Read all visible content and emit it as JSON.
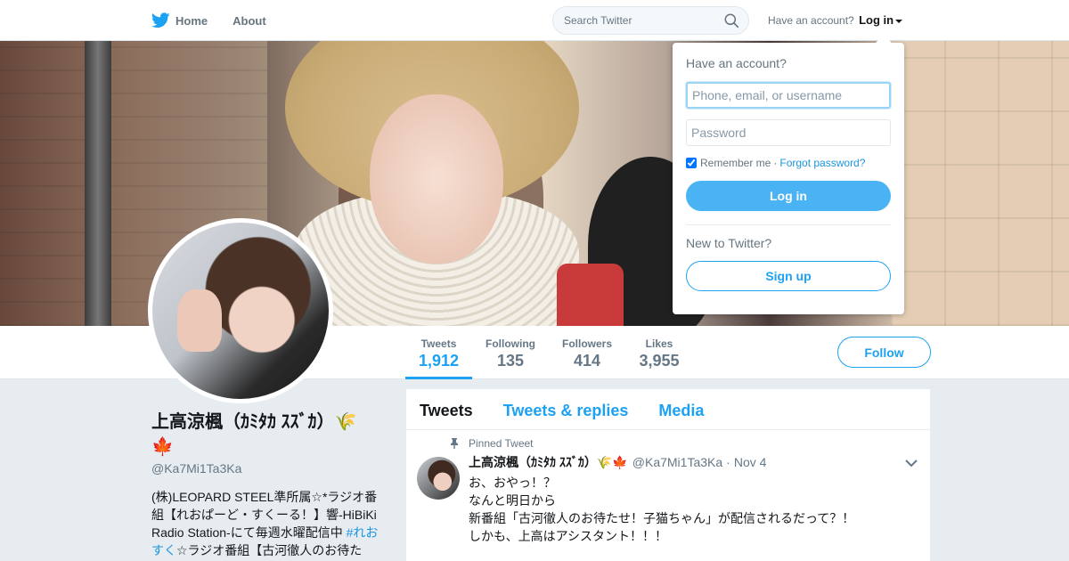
{
  "nav": {
    "home_label": "Home",
    "about_label": "About",
    "search_placeholder": "Search Twitter",
    "account_prompt": "Have an account?",
    "login_label": "Log in"
  },
  "profile_nav": {
    "stats": [
      {
        "label": "Tweets",
        "value": "1,912"
      },
      {
        "label": "Following",
        "value": "135"
      },
      {
        "label": "Followers",
        "value": "414"
      },
      {
        "label": "Likes",
        "value": "3,955"
      }
    ],
    "follow_label": "Follow"
  },
  "profile": {
    "name": "上高涼楓（ｶﾐﾀｶ ｽｽﾞｶ）🌾🍁",
    "handle": "@Ka7Mi1Ta3Ka",
    "bio_text_1": "(株)LEOPARD STEEL準所属☆*ラジオ番組【れおぱーど・すくーる！】響-HiBiKi Radio Station-にて毎週水曜配信中 ",
    "bio_tag": "#れおすく",
    "bio_text_2": "☆ラジオ番組【古河徹人のお待た"
  },
  "timeline": {
    "tabs": [
      "Tweets",
      "Tweets & replies",
      "Media"
    ],
    "pinned_label": "Pinned Tweet",
    "tweet": {
      "name": "上高涼楓（ｶﾐﾀｶ ｽｽﾞｶ）🌾🍁",
      "handle": "@Ka7Mi1Ta3Ka",
      "separator": "·",
      "date": "Nov 4",
      "lines": [
        "お、おやっ！？",
        "なんと明日から",
        "新番組「古河徹人のお待たせ！子猫ちゃん」が配信されるだって？！",
        "しかも、上高はアシスタント！！！"
      ]
    }
  },
  "login_dropdown": {
    "title": "Have an account?",
    "username_placeholder": "Phone, email, or username",
    "password_placeholder": "Password",
    "remember_label": "Remember me",
    "separator": "·",
    "forgot_label": "Forgot password?",
    "login_button": "Log in",
    "new_prompt": "New to Twitter?",
    "signup_button": "Sign up"
  },
  "colors": {
    "accent": "#1da1f2",
    "login_button": "#4ab3f4",
    "page_background": "#e6ecf0"
  }
}
